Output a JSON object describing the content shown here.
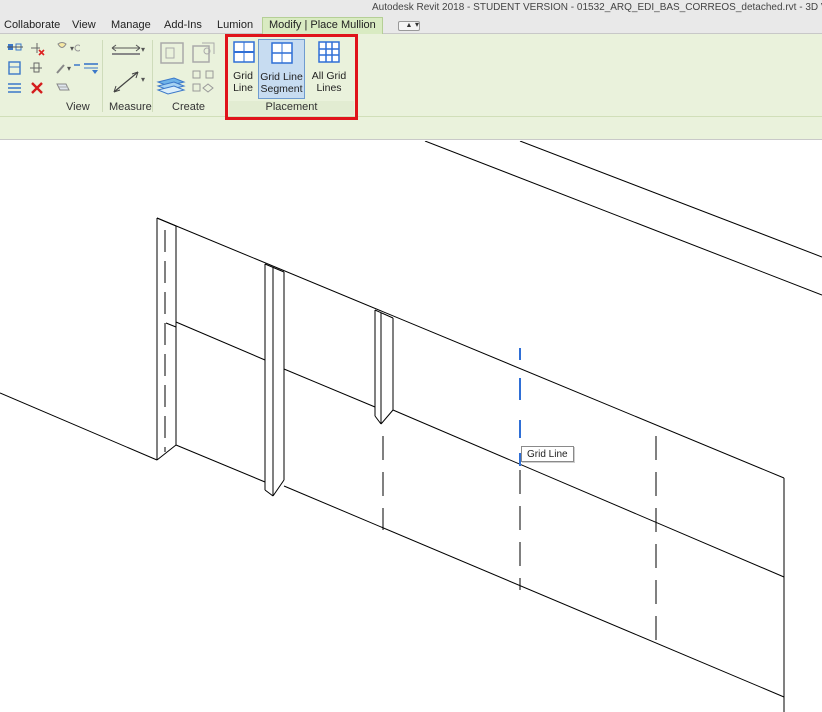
{
  "window": {
    "title": "Autodesk Revit 2018 - STUDENT VERSION -    01532_ARQ_EDI_BAS_CORREOS_detached.rvt - 3D V"
  },
  "tabs": [
    {
      "label": "Collaborate"
    },
    {
      "label": "View"
    },
    {
      "label": "Manage"
    },
    {
      "label": "Add-Ins"
    },
    {
      "label": "Lumion"
    },
    {
      "label": "Modify | Place Mullion"
    }
  ],
  "ribbon": {
    "panels": {
      "view": "View",
      "measure": "Measure",
      "create": "Create",
      "placement": "Placement"
    },
    "placement_buttons": [
      {
        "line1": "Grid",
        "line2": "Line",
        "active": false
      },
      {
        "line1": "Grid Line",
        "line2": "Segment",
        "active": true
      },
      {
        "line1": "All Grid",
        "line2": "Lines",
        "active": false
      }
    ]
  },
  "viewport": {
    "tooltip": "Grid Line"
  },
  "colors": {
    "ribbon_bg": "#eaf2dc",
    "active_tab_bg": "#d9ebc2",
    "selected_button_bg": "#c7dcf1",
    "highlight_box": "#e0141b",
    "grid_preview": "#2f6fd6"
  }
}
